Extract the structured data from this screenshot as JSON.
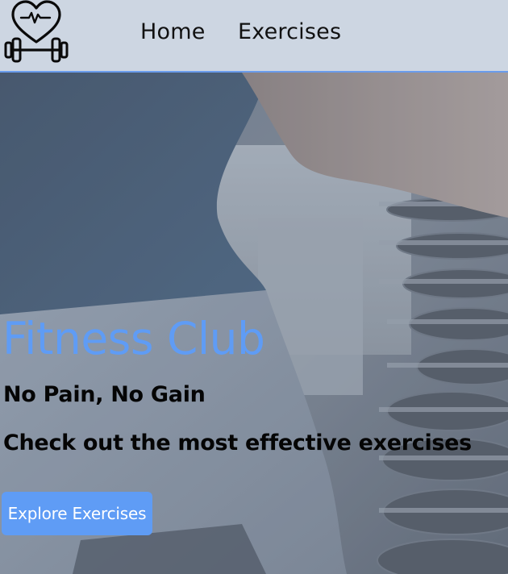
{
  "nav": {
    "links": [
      {
        "label": "Home"
      },
      {
        "label": "Exercises"
      }
    ]
  },
  "hero": {
    "title": "Fitness Club",
    "slogan": "No Pain, No Gain",
    "subtitle": "Check out the most effective exercises",
    "cta_label": "Explore Exercises"
  },
  "colors": {
    "accent": "#5f9cf5",
    "navbar_bg": "#cdd6e2",
    "navbar_border": "#6a9cec"
  },
  "icons": {
    "logo": "heart-dumbbell-logo-icon"
  }
}
